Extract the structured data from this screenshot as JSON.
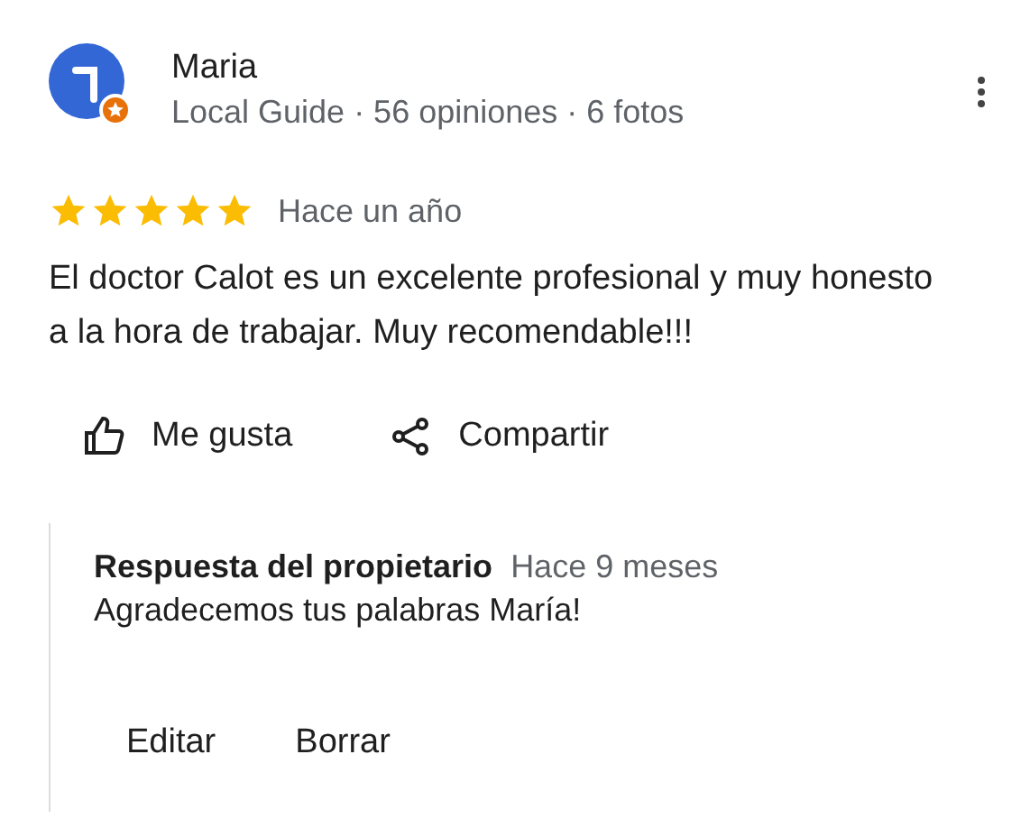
{
  "review": {
    "author": "Maria",
    "meta": "Local Guide · 56 opiniones · 6 fotos",
    "stars": 5,
    "time": "Hace un año",
    "text": "El doctor Calot es un excelente profesional y muy honesto a la hora de trabajar. Muy recomendable!!!"
  },
  "actions": [
    {
      "kind": "like",
      "label": "Me gusta"
    },
    {
      "kind": "share",
      "label": "Compartir"
    }
  ],
  "owner_reply": {
    "title": "Respuesta del propietario",
    "time": "Hace 9 meses",
    "text": "Agradecemos tus palabras María!",
    "buttons": [
      "Editar",
      "Borrar"
    ]
  }
}
